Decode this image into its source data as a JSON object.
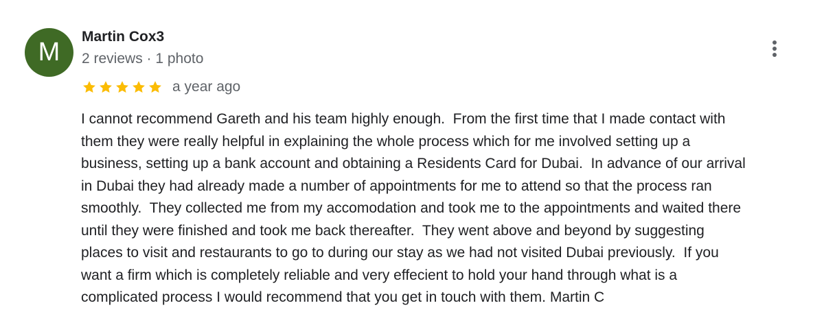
{
  "author": {
    "initial": "M",
    "name": "Martin Cox3",
    "meta": "2 reviews · 1 photo",
    "avatar_color": "#3f6a25"
  },
  "rating": {
    "stars": 5,
    "max": 5,
    "star_color": "#fbbc04",
    "time": "a year ago"
  },
  "menu": {
    "icon": "more-vert-icon"
  },
  "review_text": {
    "lines": [
      "I cannot recommend Gareth and his team highly enough.  From the first time that I made contact with",
      "them they were really helpful in explaining the whole process which for me involved setting up a",
      "business, setting up a bank account and obtaining a Residents Card for Dubai.  In advance of our arrival",
      "in Dubai they had already made a number of appointments for me to attend so that the process ran",
      "smoothly.  They collected me from my accomodation and took me to the appointments and waited there",
      "until they were finished and took me back thereafter.  They went above and beyond by suggesting",
      "places to visit and restaurants to go to during our stay as we had not visited Dubai previously.  If you",
      "want a firm which is completely reliable and very effecient to hold your hand through what is a",
      "complicated process I would recommend that you get in touch with them. Martin C"
    ]
  }
}
